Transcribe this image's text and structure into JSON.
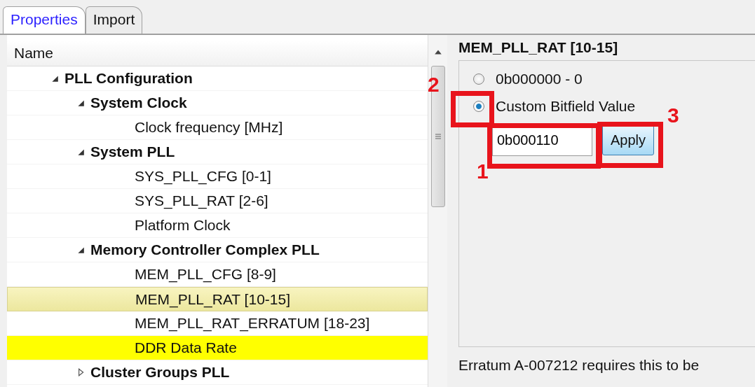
{
  "tabs": [
    {
      "label": "Properties",
      "selected": true
    },
    {
      "label": "Import",
      "selected": false
    }
  ],
  "tree": {
    "column": "Name",
    "nodes": [
      {
        "label": "PLL Configuration",
        "expanded": true,
        "selected": false,
        "highlighted": false,
        "children": [
          {
            "label": "System Clock",
            "expanded": true,
            "selected": false,
            "highlighted": false,
            "children": [
              {
                "label": "Clock frequency [MHz]",
                "selected": false,
                "highlighted": false
              }
            ]
          },
          {
            "label": "System PLL",
            "expanded": true,
            "selected": false,
            "highlighted": false,
            "children": [
              {
                "label": "SYS_PLL_CFG   [0-1]",
                "selected": false,
                "highlighted": false
              },
              {
                "label": "SYS_PLL_RAT   [2-6]",
                "selected": false,
                "highlighted": false
              },
              {
                "label": "Platform Clock",
                "selected": false,
                "highlighted": false
              }
            ]
          },
          {
            "label": "Memory Controller Complex PLL",
            "expanded": true,
            "selected": false,
            "highlighted": false,
            "children": [
              {
                "label": "MEM_PLL_CFG   [8-9]",
                "selected": false,
                "highlighted": false
              },
              {
                "label": "MEM_PLL_RAT   [10-15]",
                "selected": true,
                "highlighted": false
              },
              {
                "label": "MEM_PLL_RAT_ERRATUM   [18-23]",
                "selected": false,
                "highlighted": false
              },
              {
                "label": "DDR Data Rate",
                "selected": false,
                "highlighted": true
              }
            ]
          },
          {
            "label": "Cluster Groups PLL",
            "expanded": false,
            "selected": false,
            "highlighted": false
          }
        ]
      }
    ]
  },
  "detail": {
    "title": "MEM_PLL_RAT   [10-15]",
    "options": [
      {
        "label": "0b000000 - 0",
        "selected": false
      },
      {
        "label": "Custom Bitfield Value",
        "selected": true
      }
    ],
    "value": "0b000110",
    "apply": "Apply",
    "note": "Erratum A-007212 requires this to be"
  },
  "annotations": [
    {
      "number": "2"
    },
    {
      "number": "1"
    },
    {
      "number": "3"
    }
  ]
}
